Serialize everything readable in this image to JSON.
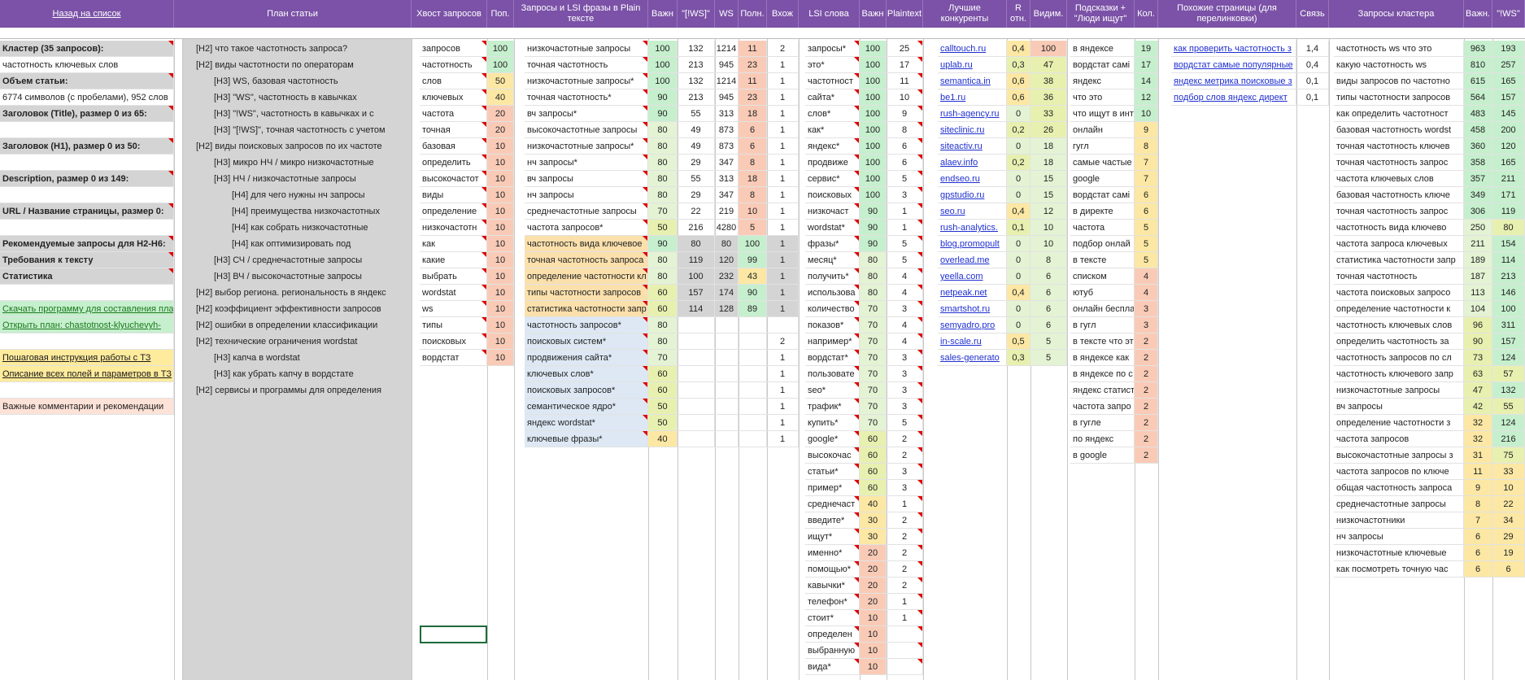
{
  "headers": [
    "Назад на список",
    "План статьи",
    "Хвост запросов",
    "Поп.",
    "Запросы и LSI фразы в Plain тексте",
    "Важн",
    "\"[!WS]\"",
    "WS",
    "Полн.",
    "Вхож",
    "LSI слова",
    "Важн",
    "Plaintext",
    "Лучшие конкуренты",
    "R отн.",
    "Видим.",
    "Подсказки + \"Люди ищут\"",
    "Кол.",
    "Похожие страницы (для перелинковки)",
    "Связь",
    "Запросы кластера",
    "Важн.",
    "\"!WS\""
  ],
  "left": [
    {
      "t": "Кластер (35 запросов):",
      "s": "bold g"
    },
    {
      "t": "частотность ключевых слов",
      "s": ""
    },
    {
      "t": "Объем статьи:",
      "s": "bold g"
    },
    {
      "t": "6774 символов (с пробелами), 952 слов",
      "s": ""
    },
    {
      "t": "Заголовок (Title), размер 0 из 65:",
      "s": "bold g"
    },
    {
      "t": "",
      "s": ""
    },
    {
      "t": "Заголовок (H1), размер 0 из 50:",
      "s": "bold g"
    },
    {
      "t": "",
      "s": ""
    },
    {
      "t": "Description, размер 0 из 149:",
      "s": "bold g"
    },
    {
      "t": "",
      "s": ""
    },
    {
      "t": "URL / Название страницы, размер 0:",
      "s": "bold g"
    },
    {
      "t": "",
      "s": ""
    },
    {
      "t": "Рекомендуемые запросы для H2-H6:",
      "s": "bold g"
    },
    {
      "t": "Требования к тексту",
      "s": "bold g"
    },
    {
      "t": "Статистика",
      "s": "bold g"
    },
    {
      "t": "",
      "s": ""
    },
    {
      "t": "Скачать программу для составления план",
      "s": "gl grn"
    },
    {
      "t": "Открыть план: chastotnost-klyuchevyh-",
      "s": "gl grn"
    },
    {
      "t": "",
      "s": ""
    },
    {
      "t": "Пошаговая инструкция работы с ТЗ",
      "s": "lnkd ylh"
    },
    {
      "t": "Описание всех полей и параметров в ТЗ",
      "s": "lnkd ylh"
    },
    {
      "t": "",
      "s": ""
    },
    {
      "t": "Важные комментарии и рекомендации",
      "s": "ltpk"
    }
  ],
  "plan": [
    {
      "t": "[H2] что такое частотность запроса?",
      "i": 0
    },
    {
      "t": "[H2] виды частотности по операторам",
      "i": 0
    },
    {
      "t": "[H3] WS, базовая частотность",
      "i": 1
    },
    {
      "t": "[H3] \"WS\", частотность в кавычках",
      "i": 1
    },
    {
      "t": "[H3] \"!WS\", частотность в кавычках и с",
      "i": 1
    },
    {
      "t": "[H3] \"[!WS]\", точная частотность с учетом",
      "i": 1
    },
    {
      "t": "[H2] виды поисковых запросов по их частоте",
      "i": 0
    },
    {
      "t": "[H3] микро НЧ / микро низкочастотные",
      "i": 1
    },
    {
      "t": "[H3] НЧ / низкочастотные запросы",
      "i": 1
    },
    {
      "t": "[H4] для чего нужны нч запросы",
      "i": 2
    },
    {
      "t": "[H4] преимущества низкочастотных",
      "i": 2
    },
    {
      "t": "[H4] как собрать низкочастотные",
      "i": 2
    },
    {
      "t": "[H4] как оптимизировать под",
      "i": 2
    },
    {
      "t": "[H3] СЧ / среднечастотные запросы",
      "i": 1
    },
    {
      "t": "[H3] ВЧ / высокочастотные запросы",
      "i": 1
    },
    {
      "t": "[H2] выбор региона. региональность в яндекс",
      "i": 0
    },
    {
      "t": "[H2] коэффициент эффективности запросов",
      "i": 0
    },
    {
      "t": "[H2] ошибки в определении классификации",
      "i": 0
    },
    {
      "t": "[H2] технические ограничения wordstat",
      "i": 0
    },
    {
      "t": "[H3] капча в wordstat",
      "i": 1
    },
    {
      "t": "[H3] как убрать капчу в вордстате",
      "i": 1
    },
    {
      "t": "[H2] сервисы и программы для определения",
      "i": 0
    }
  ],
  "tails": [
    [
      "запросов",
      "100"
    ],
    [
      "частотность",
      "100"
    ],
    [
      "слов",
      "50"
    ],
    [
      "ключевых",
      "40"
    ],
    [
      "частота",
      "20"
    ],
    [
      "точная",
      "20"
    ],
    [
      "базовая",
      "10"
    ],
    [
      "определить",
      "10"
    ],
    [
      "высокочастот",
      "10"
    ],
    [
      "виды",
      "10"
    ],
    [
      "определение",
      "10"
    ],
    [
      "низкочастотн",
      "10"
    ],
    [
      "как",
      "10"
    ],
    [
      "какие",
      "10"
    ],
    [
      "выбрать",
      "10"
    ],
    [
      "wordstat",
      "10"
    ],
    [
      "ws",
      "10"
    ],
    [
      "типы",
      "10"
    ],
    [
      "поисковых",
      "10"
    ],
    [
      "вордстат",
      "10"
    ]
  ],
  "plain": [
    [
      "низкочастотные запросы",
      "100",
      "132",
      "1214",
      "11",
      "2",
      "g"
    ],
    [
      "точная частотность",
      "100",
      "213",
      "945",
      "23",
      "1",
      "g"
    ],
    [
      "низкочастотные запросы*",
      "100",
      "132",
      "1214",
      "11",
      "1",
      "g"
    ],
    [
      "точная частотность*",
      "90",
      "213",
      "945",
      "23",
      "1",
      "g"
    ],
    [
      "вч запросы*",
      "90",
      "55",
      "313",
      "18",
      "1",
      "g"
    ],
    [
      "высокочастотные запросы",
      "80",
      "49",
      "873",
      "6",
      "1",
      "g"
    ],
    [
      "низкочастотные запросы*",
      "80",
      "49",
      "873",
      "6",
      "1",
      "g"
    ],
    [
      "нч запросы*",
      "80",
      "29",
      "347",
      "8",
      "1",
      "g"
    ],
    [
      "вч запросы",
      "80",
      "55",
      "313",
      "18",
      "1",
      "g"
    ],
    [
      "нч запросы",
      "80",
      "29",
      "347",
      "8",
      "1",
      "g"
    ],
    [
      "среднечастотные запросы",
      "70",
      "22",
      "219",
      "10",
      "1",
      "g"
    ],
    [
      "частота запросов*",
      "50",
      "216",
      "4280",
      "5",
      "1",
      "g"
    ],
    [
      "частотность вида ключевое",
      "90",
      "80",
      "80",
      "100",
      "1",
      "y"
    ],
    [
      "точная частотность запроса",
      "80",
      "119",
      "120",
      "99",
      "1",
      "y"
    ],
    [
      "определение частотности кл",
      "80",
      "100",
      "232",
      "43",
      "1",
      "y"
    ],
    [
      "типы частотности запросов",
      "60",
      "157",
      "174",
      "90",
      "1",
      "y"
    ],
    [
      "статистика частотности запр",
      "60",
      "114",
      "128",
      "89",
      "1",
      "y"
    ],
    [
      "частотность запросов*",
      "80",
      "",
      "",
      "",
      "",
      "b"
    ],
    [
      "поисковых систем*",
      "80",
      "",
      "",
      "",
      "2",
      "b"
    ],
    [
      "продвижения сайта*",
      "70",
      "",
      "",
      "",
      "1",
      "b"
    ],
    [
      "ключевых слов*",
      "60",
      "",
      "",
      "",
      "1",
      "b"
    ],
    [
      "поисковых запросов*",
      "60",
      "",
      "",
      "",
      "1",
      "b"
    ],
    [
      "семантическое ядро*",
      "50",
      "",
      "",
      "",
      "1",
      "b"
    ],
    [
      "яндекс wordstat*",
      "50",
      "",
      "",
      "",
      "1",
      "b"
    ],
    [
      "ключевые фразы*",
      "40",
      "",
      "",
      "",
      "1",
      "b"
    ]
  ],
  "lsi": [
    [
      "запросы*",
      "100",
      "25"
    ],
    [
      "это*",
      "100",
      "17"
    ],
    [
      "частотност",
      "100",
      "11"
    ],
    [
      "сайта*",
      "100",
      "10"
    ],
    [
      "слов*",
      "100",
      "9"
    ],
    [
      "как*",
      "100",
      "8"
    ],
    [
      "яндекс*",
      "100",
      "6"
    ],
    [
      "продвиже",
      "100",
      "6"
    ],
    [
      "сервис*",
      "100",
      "5"
    ],
    [
      "поисковых",
      "100",
      "3"
    ],
    [
      "низкочаст",
      "90",
      "1"
    ],
    [
      "wordstat*",
      "90",
      "1"
    ],
    [
      "фразы*",
      "90",
      "5"
    ],
    [
      "месяц*",
      "80",
      "5"
    ],
    [
      "получить*",
      "80",
      "4"
    ],
    [
      "использова",
      "80",
      "4"
    ],
    [
      "количество",
      "70",
      "3"
    ],
    [
      "показов*",
      "70",
      "4"
    ],
    [
      "например*",
      "70",
      "4"
    ],
    [
      "вордстат*",
      "70",
      "3"
    ],
    [
      "пользовате",
      "70",
      "3"
    ],
    [
      "seo*",
      "70",
      "3"
    ],
    [
      "трафик*",
      "70",
      "3"
    ],
    [
      "купить*",
      "70",
      "5"
    ],
    [
      "google*",
      "60",
      "2"
    ],
    [
      "высокочас",
      "60",
      "2"
    ],
    [
      "статьи*",
      "60",
      "3"
    ],
    [
      "пример*",
      "60",
      "3"
    ],
    [
      "среднечаст",
      "40",
      "1"
    ],
    [
      "введите*",
      "30",
      "2"
    ],
    [
      "ищут*",
      "30",
      "2"
    ],
    [
      "именно*",
      "20",
      "2"
    ],
    [
      "помощью*",
      "20",
      "2"
    ],
    [
      "кавычки*",
      "20",
      "2"
    ],
    [
      "телефон*",
      "20",
      "1"
    ],
    [
      "стоит*",
      "10",
      "1"
    ],
    [
      "определен",
      "10",
      ""
    ],
    [
      "выбранную",
      "10",
      ""
    ],
    [
      "вида*",
      "10",
      ""
    ]
  ],
  "comp": [
    [
      "calltouch.ru",
      "0,4",
      "100"
    ],
    [
      "uplab.ru",
      "0,3",
      "47"
    ],
    [
      "semantica.in",
      "0,6",
      "38"
    ],
    [
      "be1.ru",
      "0,6",
      "36"
    ],
    [
      "rush-agency.ru",
      "0",
      "33"
    ],
    [
      "siteclinic.ru",
      "0,2",
      "26"
    ],
    [
      "siteactiv.ru",
      "0",
      "18"
    ],
    [
      "alaev.info",
      "0,2",
      "18"
    ],
    [
      "endseo.ru",
      "0",
      "15"
    ],
    [
      "gpstudio.ru",
      "0",
      "15"
    ],
    [
      "seo.ru",
      "0,4",
      "12"
    ],
    [
      "rush-analytics.",
      "0,1",
      "10"
    ],
    [
      "blog.promopult",
      "0",
      "10"
    ],
    [
      "overlead.me",
      "0",
      "8"
    ],
    [
      "yeella.com",
      "0",
      "6"
    ],
    [
      "netpeak.net",
      "0,4",
      "6"
    ],
    [
      "smartshot.ru",
      "0",
      "6"
    ],
    [
      "semyadro.pro",
      "0",
      "6"
    ],
    [
      "in-scale.ru",
      "0,5",
      "5"
    ],
    [
      "sales-generato",
      "0,3",
      "5"
    ]
  ],
  "hints": [
    [
      "в яндексе",
      "19"
    ],
    [
      "вордстат самі",
      "17"
    ],
    [
      "яндекс",
      "14"
    ],
    [
      "что это",
      "12"
    ],
    [
      "что ищут в инт",
      "10"
    ],
    [
      "онлайн",
      "9"
    ],
    [
      "гугл",
      "8"
    ],
    [
      "самые частые",
      "7"
    ],
    [
      "google",
      "7"
    ],
    [
      "вордстат самі",
      "6"
    ],
    [
      "в директе",
      "6"
    ],
    [
      "частота",
      "5"
    ],
    [
      "подбор онлай",
      "5"
    ],
    [
      "в тексте",
      "5"
    ],
    [
      "списком",
      "4"
    ],
    [
      "ютуб",
      "4"
    ],
    [
      "онлайн беспла",
      "3"
    ],
    [
      "в гугл",
      "3"
    ],
    [
      "в тексте что эт",
      "2"
    ],
    [
      "в яндексе как",
      "2"
    ],
    [
      "в яндексе по с",
      "2"
    ],
    [
      "яндекс статист",
      "2"
    ],
    [
      "частота запро",
      "2"
    ],
    [
      "в гугле",
      "2"
    ],
    [
      "по яндекс",
      "2"
    ],
    [
      "в google",
      "2"
    ]
  ],
  "similar": [
    [
      "как проверить частотность з",
      "1,4"
    ],
    [
      "вордстат самые популярные",
      "0,4"
    ],
    [
      "яндекс метрика поисковые з",
      "0,1"
    ],
    [
      "подбор слов яндекс директ",
      "0,1"
    ]
  ],
  "cluster": [
    [
      "частотность ws что это",
      "963",
      "193"
    ],
    [
      "какую частотность ws",
      "810",
      "257"
    ],
    [
      "виды запросов по частотно",
      "615",
      "165"
    ],
    [
      "типы частотности запросов",
      "564",
      "157"
    ],
    [
      "как определить частотност",
      "483",
      "145"
    ],
    [
      "базовая частотность wordst",
      "458",
      "200"
    ],
    [
      "точная частотность ключев",
      "360",
      "120"
    ],
    [
      "точная частотность запрос",
      "358",
      "165"
    ],
    [
      "частота ключевых слов",
      "357",
      "211"
    ],
    [
      "базовая частотность ключе",
      "349",
      "171"
    ],
    [
      "точная частотность запрос",
      "306",
      "119"
    ],
    [
      "частотность вида ключево",
      "250",
      "80"
    ],
    [
      "частота запроса ключевых",
      "211",
      "154"
    ],
    [
      "статистика частотности запр",
      "189",
      "114"
    ],
    [
      "точная частотность",
      "187",
      "213"
    ],
    [
      "частота поисковых запросо",
      "113",
      "146"
    ],
    [
      "определение частотности к",
      "104",
      "100"
    ],
    [
      "частотность ключевых слов",
      "96",
      "311"
    ],
    [
      "определить частотность за",
      "90",
      "157"
    ],
    [
      "частотность запросов по сл",
      "73",
      "124"
    ],
    [
      "частотность ключевого запр",
      "63",
      "57"
    ],
    [
      "низкочастотные запросы",
      "47",
      "132"
    ],
    [
      "вч запросы",
      "42",
      "55"
    ],
    [
      "определение частотности з",
      "32",
      "124"
    ],
    [
      "частота запросов",
      "32",
      "216"
    ],
    [
      "высокочастотные запросы з",
      "31",
      "75"
    ],
    [
      "частота запросов по ключе",
      "11",
      "33"
    ],
    [
      "общая частотность запроса",
      "9",
      "10"
    ],
    [
      "среднечастотные запросы",
      "8",
      "22"
    ],
    [
      "низкочастотники",
      "7",
      "34"
    ],
    [
      "нч запросы",
      "6",
      "29"
    ],
    [
      "низкочастотные ключевые",
      "6",
      "19"
    ],
    [
      "как посмотреть точную час",
      "6",
      "6"
    ]
  ]
}
